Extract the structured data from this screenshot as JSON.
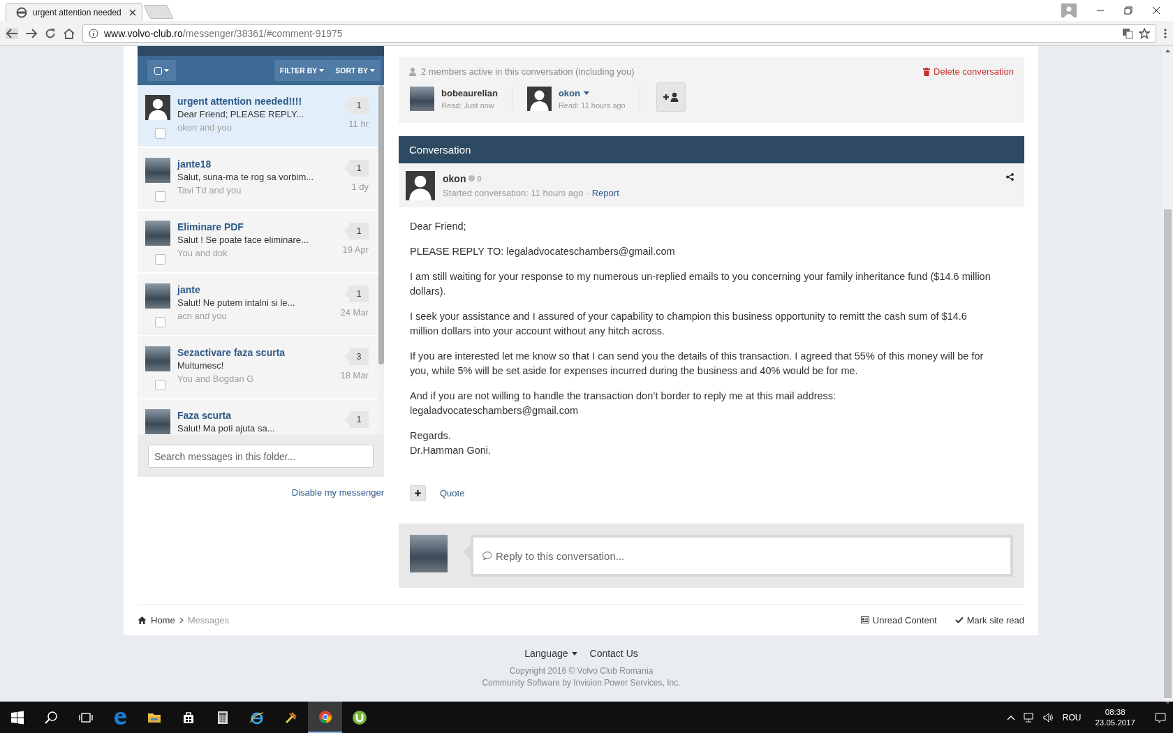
{
  "browser": {
    "tab_title": "urgent attention needed",
    "url_host": "www.volvo-club.ro",
    "url_path": "/messenger/38361/#comment-91975"
  },
  "sidebar": {
    "filter_label": "FILTER BY",
    "sort_label": "SORT BY",
    "conversations": [
      {
        "title": "urgent attention needed!!!!",
        "snippet": "Dear Friend; PLEASE REPLY...",
        "participants": "okon and you",
        "count": "1",
        "time": "11 hr",
        "photo": false,
        "selected": true,
        "checked": false
      },
      {
        "title": "jante18",
        "snippet": "Salut, suna-ma te rog sa vorbim...",
        "participants": "Tavi Td and you",
        "count": "1",
        "time": "1 dy",
        "photo": true,
        "selected": false,
        "checked": false
      },
      {
        "title": "Eliminare PDF",
        "snippet": "Salut ! Se poate face eliminare...",
        "participants": "You and dok",
        "count": "1",
        "time": "19 Apr",
        "photo": true,
        "selected": false,
        "checked": false
      },
      {
        "title": "jante",
        "snippet": "Salut! Ne putem intalni si le...",
        "participants": "acn and you",
        "count": "1",
        "time": "24 Mar",
        "photo": true,
        "selected": false,
        "checked": false
      },
      {
        "title": "Sezactivare faza scurta",
        "snippet": "Multumesc!",
        "participants": "You and Bogdan G",
        "count": "3",
        "time": "18 Mar",
        "photo": true,
        "selected": false,
        "checked": false
      },
      {
        "title": "Faza scurta",
        "snippet": "Salut! Ma poti ajuta sa...",
        "count": "1",
        "photo": true,
        "selected": false
      }
    ],
    "search": {
      "placeholder": "Search messages in this folder..."
    },
    "disable_link": "Disable my messenger"
  },
  "members": {
    "summary": "2 members active in this conversation (including you)",
    "delete": "Delete conversation",
    "list": [
      {
        "name": "bobeaurelian",
        "read": "Read: Just now",
        "photo": true,
        "has_menu": false
      },
      {
        "name": "okon",
        "read": "Read: 11 hours ago",
        "photo": false,
        "has_menu": true
      }
    ]
  },
  "conversation": {
    "title": "Conversation",
    "author": "okon",
    "reputation": "0",
    "meta": "Started conversation: 11 hours ago",
    "separator": "·",
    "report": "Report",
    "paragraphs": [
      "Dear Friend;",
      "PLEASE REPLY TO: legaladvocateschambers@gmail.com",
      "I am still waiting for your response to my numerous un-replied emails to you concerning your family inheritance fund ($14.6 million dollars).",
      "I seek your assistance and I assured of your capability to champion this business opportunity to remitt the cash sum of  $14.6 million dollars into your account without any hitch across.",
      "If you are interested let me know so that I can send you the details of this transaction. I agreed that 55% of this money will be for you, while 5% will be set aside for expenses incurred during the business and 40% would be for me.",
      "And if you are not willing to handle the transaction don’t border to reply me at this mail address:  legaladvocateschambers@gmail.com",
      "Regards.\nDr.Hamman Goni."
    ],
    "quote": "Quote",
    "reply_placeholder": "Reply to this conversation..."
  },
  "breadcrumb": [
    "Home",
    "Messages"
  ],
  "page_actions": [
    "Unread Content",
    "Mark site read"
  ],
  "footer": {
    "language": "Language",
    "contact": "Contact Us",
    "copyright": "Copyright 2016 © Volvo Club Romania",
    "software": "Community Software by Invision Power Services, Inc."
  },
  "taskbar": {
    "apps": [
      {
        "kind": "edge",
        "active": false
      },
      {
        "kind": "folder",
        "active": false
      },
      {
        "kind": "store",
        "active": false
      },
      {
        "kind": "calculator",
        "active": false
      },
      {
        "kind": "ie",
        "active": false
      },
      {
        "kind": "tool",
        "active": false
      },
      {
        "kind": "chrome",
        "active": true
      },
      {
        "kind": "torrent",
        "active": false
      }
    ],
    "language": "ROU",
    "time": "08:38",
    "date": "23.05.2017"
  }
}
